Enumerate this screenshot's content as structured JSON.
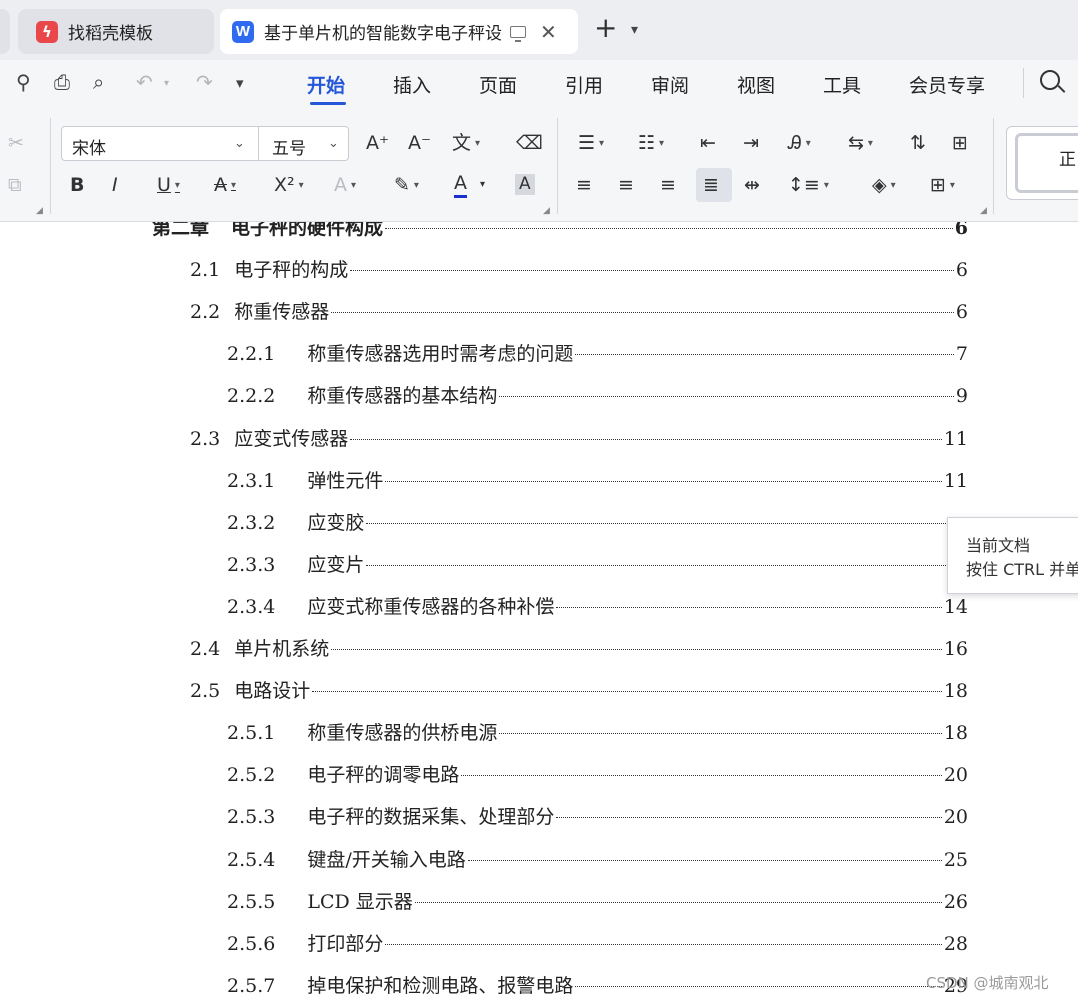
{
  "tabs": {
    "templates_label": "找稻壳模板",
    "document_label": "基于单片机的智能数字电子秤设",
    "document_icon_letter": "W",
    "new_tab_glyph": "+",
    "menu_glyph": "⌄"
  },
  "menu": {
    "items": [
      "开始",
      "插入",
      "页面",
      "引用",
      "审阅",
      "视图",
      "工具",
      "会员专享"
    ],
    "active": "开始"
  },
  "ribbon": {
    "font_name": "宋体",
    "font_size": "五号",
    "style_label": "正"
  },
  "toc": [
    {
      "num": "第二章",
      "title": "电子秤的硬件构成",
      "page": "6",
      "level": 0
    },
    {
      "num": "2.1",
      "title": "电子秤的构成",
      "page": "6",
      "level": 1
    },
    {
      "num": "2.2",
      "title": "称重传感器",
      "page": "6",
      "level": 1
    },
    {
      "num": "2.2.1",
      "title": "称重传感器选用时需考虑的问题",
      "page": "7",
      "level": 2
    },
    {
      "num": "2.2.2",
      "title": "称重传感器的基本结构",
      "page": "9",
      "level": 2
    },
    {
      "num": "2.3",
      "title": "应变式传感器",
      "page": "11",
      "level": 1
    },
    {
      "num": "2.3.1",
      "title": "弹性元件",
      "page": "11",
      "level": 2
    },
    {
      "num": "2.3.2",
      "title": "应变胶",
      "page": "",
      "level": 2
    },
    {
      "num": "2.3.3",
      "title": "应变片",
      "page": "",
      "level": 2
    },
    {
      "num": "2.3.4",
      "title": "应变式称重传感器的各种补偿",
      "page": "14",
      "level": 2
    },
    {
      "num": "2.4",
      "title": "单片机系统",
      "page": "16",
      "level": 1
    },
    {
      "num": "2.5",
      "title": "电路设计",
      "page": "18",
      "level": 1
    },
    {
      "num": "2.5.1",
      "title": "称重传感器的供桥电源",
      "page": "18",
      "level": 2
    },
    {
      "num": "2.5.2",
      "title": "电子秤的调零电路",
      "page": "20",
      "level": 2
    },
    {
      "num": "2.5.3",
      "title": "电子秤的数据采集、处理部分",
      "page": "20",
      "level": 2
    },
    {
      "num": "2.5.4",
      "title": "键盘/开关输入电路",
      "page": "25",
      "level": 2
    },
    {
      "num": "2.5.5",
      "title": "LCD 显示器",
      "page": "26",
      "level": 2
    },
    {
      "num": "2.5.6",
      "title": "打印部分",
      "page": "28",
      "level": 2
    },
    {
      "num": "2.5.7",
      "title": "掉电保护和检测电路、报警电路",
      "page": "29",
      "level": 2
    }
  ],
  "tooltip": {
    "line1": "当前文档",
    "line2": "按住 CTRL 并单"
  },
  "watermark": "CSDN @城南观北",
  "colors": {
    "accent": "#2458d8",
    "templates_icon": "#e9474a",
    "writer_icon": "#2f6bf0"
  }
}
